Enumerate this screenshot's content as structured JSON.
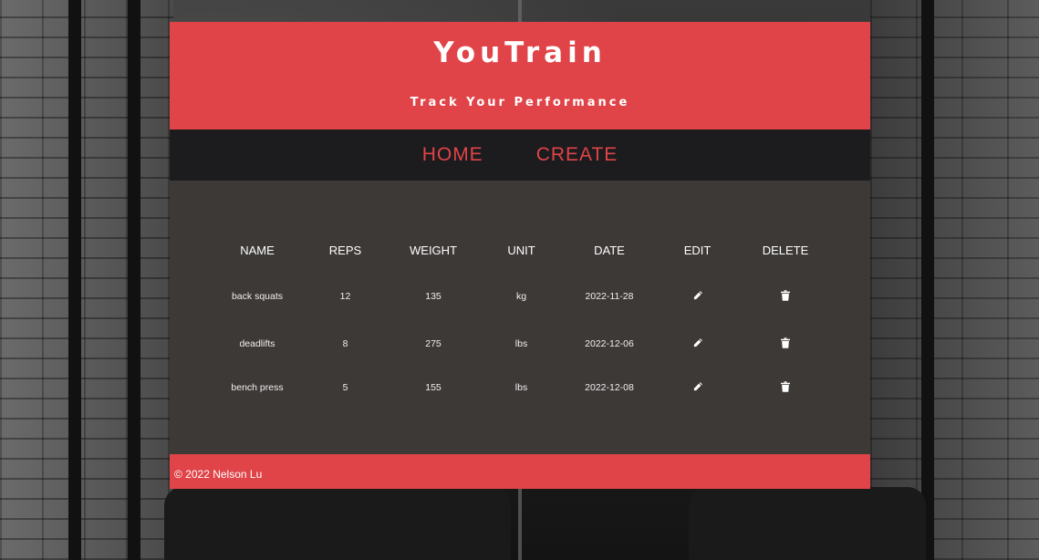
{
  "header": {
    "title": "YouTrain",
    "subtitle": "Track Your Performance"
  },
  "nav": {
    "items": [
      {
        "label": "HOME"
      },
      {
        "label": "CREATE"
      }
    ]
  },
  "table": {
    "columns": [
      "NAME",
      "REPS",
      "WEIGHT",
      "UNIT",
      "DATE",
      "EDIT",
      "DELETE"
    ],
    "rows": [
      {
        "name": "back squats",
        "reps": "12",
        "weight": "135",
        "unit": "kg",
        "date": "2022-11-28"
      },
      {
        "name": "deadlifts",
        "reps": "8",
        "weight": "275",
        "unit": "lbs",
        "date": "2022-12-06"
      },
      {
        "name": "bench press",
        "reps": "5",
        "weight": "155",
        "unit": "lbs",
        "date": "2022-12-08"
      }
    ],
    "edit_icon": "pencil-icon",
    "delete_icon": "trash-icon"
  },
  "footer": {
    "text": "© 2022 Nelson Lu"
  },
  "colors": {
    "accent": "#e04448",
    "nav_bg": "#1c1b1e",
    "main_bg": "#3d3937"
  }
}
